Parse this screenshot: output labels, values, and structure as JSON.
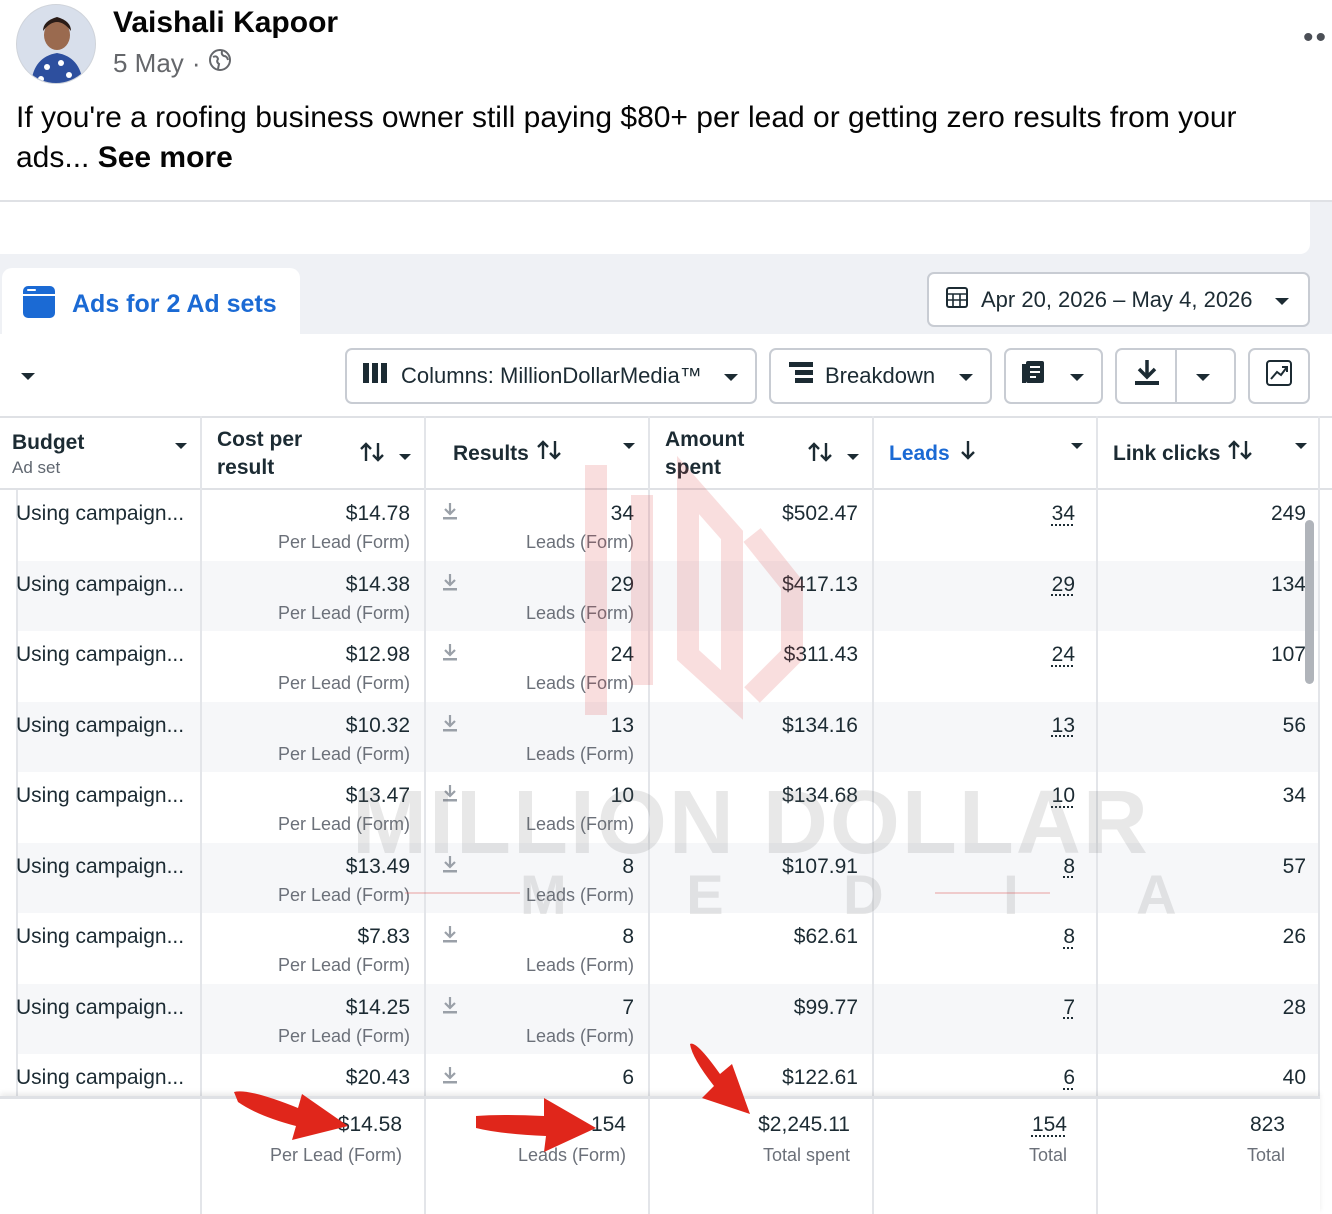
{
  "post": {
    "author": "Vaishali Kapoor",
    "date": "5 May",
    "separator": "·",
    "text": "If you're a roofing business owner still paying $80+ per lead or getting zero results from your ads...",
    "see_more": "See more"
  },
  "ads": {
    "tab_label": "Ads for 2 Ad sets",
    "date_range": "Apr 20, 2026 – May 4, 2026",
    "toolbar": {
      "columns_label": "Columns: MillionDollarMedia™",
      "breakdown_label": "Breakdown"
    },
    "headers": {
      "budget": "Budget",
      "budget_sub": "Ad set",
      "cost_per_result": "Cost per result",
      "results": "Results",
      "amount_spent": "Amount spent",
      "leads": "Leads",
      "link_clicks": "Link clicks"
    },
    "rows": [
      {
        "budget": "Using campaign...",
        "cpr": "$14.78",
        "cpr_sub": "Per Lead (Form)",
        "results": "34",
        "results_sub": "Leads (Form)",
        "spent": "$502.47",
        "leads": "34",
        "clicks": "249"
      },
      {
        "budget": "Using campaign...",
        "cpr": "$14.38",
        "cpr_sub": "Per Lead (Form)",
        "results": "29",
        "results_sub": "Leads (Form)",
        "spent": "$417.13",
        "leads": "29",
        "clicks": "134"
      },
      {
        "budget": "Using campaign...",
        "cpr": "$12.98",
        "cpr_sub": "Per Lead (Form)",
        "results": "24",
        "results_sub": "Leads (Form)",
        "spent": "$311.43",
        "leads": "24",
        "clicks": "107"
      },
      {
        "budget": "Using campaign...",
        "cpr": "$10.32",
        "cpr_sub": "Per Lead (Form)",
        "results": "13",
        "results_sub": "Leads (Form)",
        "spent": "$134.16",
        "leads": "13",
        "clicks": "56"
      },
      {
        "budget": "Using campaign...",
        "cpr": "$13.47",
        "cpr_sub": "Per Lead (Form)",
        "results": "10",
        "results_sub": "Leads (Form)",
        "spent": "$134.68",
        "leads": "10",
        "clicks": "34"
      },
      {
        "budget": "Using campaign...",
        "cpr": "$13.49",
        "cpr_sub": "Per Lead (Form)",
        "results": "8",
        "results_sub": "Leads (Form)",
        "spent": "$107.91",
        "leads": "8",
        "clicks": "57"
      },
      {
        "budget": "Using campaign...",
        "cpr": "$7.83",
        "cpr_sub": "Per Lead (Form)",
        "results": "8",
        "results_sub": "Leads (Form)",
        "spent": "$62.61",
        "leads": "8",
        "clicks": "26"
      },
      {
        "budget": "Using campaign...",
        "cpr": "$14.25",
        "cpr_sub": "Per Lead (Form)",
        "results": "7",
        "results_sub": "Leads (Form)",
        "spent": "$99.77",
        "leads": "7",
        "clicks": "28"
      },
      {
        "budget": "Using campaign...",
        "cpr": "$20.43",
        "cpr_sub": "",
        "results": "6",
        "results_sub": "",
        "spent": "$122.61",
        "leads": "6",
        "clicks": "40"
      }
    ],
    "totals": {
      "cpr": "$14.58",
      "cpr_sub": "Per Lead (Form)",
      "results": "154",
      "results_sub": "Leads (Form)",
      "spent": "$2,245.11",
      "spent_sub": "Total spent",
      "leads": "154",
      "leads_sub": "Total",
      "clicks": "823",
      "clicks_sub": "Total"
    }
  },
  "watermark": {
    "line1": "MILLION DOLLAR",
    "line2": "M E D I A"
  },
  "colors": {
    "accent": "#1b6ad4",
    "arrow": "#e0261b",
    "text": "#1c2b33"
  }
}
